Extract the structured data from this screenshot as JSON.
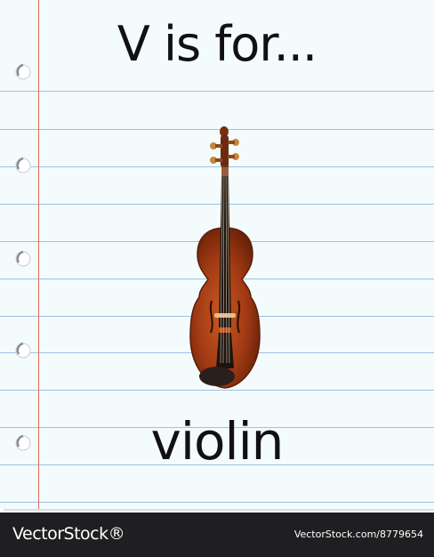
{
  "card": {
    "heading": "V is for...",
    "word": "violin",
    "illustration": "violin-illustration"
  },
  "footer": {
    "logo": "VectorStock®",
    "image_id": "VectorStock.com/8779654"
  },
  "colors": {
    "paper": "#f4fbfc",
    "rule_line": "#9dc1e6",
    "margin_line": "#e06a5a",
    "footer_bg": "#1f1f22",
    "violin_body": "#a23a14"
  }
}
